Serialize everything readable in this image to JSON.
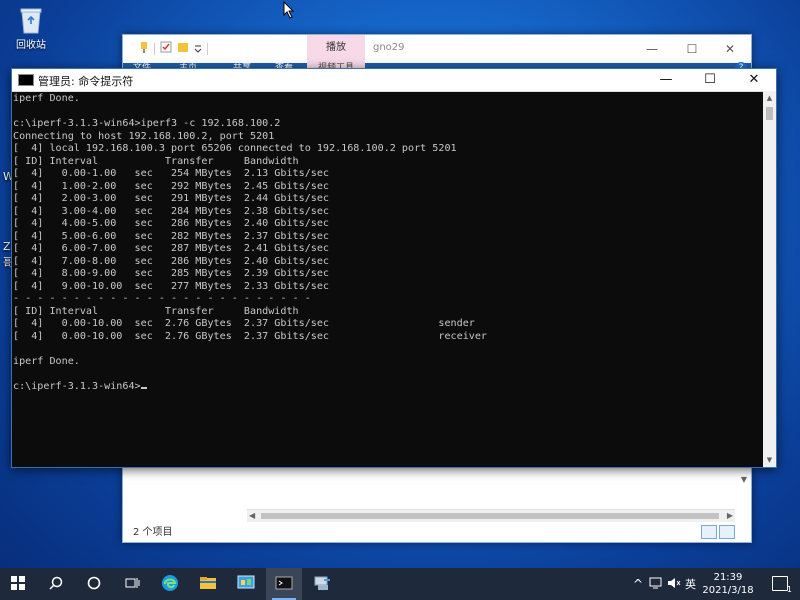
{
  "desktop": {
    "recycle_bin_label": "回收站",
    "left_fragments": [
      "W",
      "Z",
      "哥"
    ]
  },
  "explorer": {
    "context_tab": "播放",
    "title": "gno29",
    "ribbon_tabs": [
      "文件",
      "主页",
      "共享",
      "查看"
    ],
    "ribbon_context_tab": "视频工具",
    "status_text": "2 个项目",
    "controls": {
      "minimize": "—",
      "maximize": "☐",
      "close": "✕"
    },
    "help_icon": "?"
  },
  "cmd": {
    "title": "管理员: 命令提示符",
    "controls": {
      "minimize": "—",
      "maximize": "☐",
      "close": "✕"
    },
    "lines": [
      "iperf Done.",
      "",
      "c:\\iperf-3.1.3-win64>iperf3 -c 192.168.100.2",
      "Connecting to host 192.168.100.2, port 5201",
      "[  4] local 192.168.100.3 port 65206 connected to 192.168.100.2 port 5201",
      "[ ID] Interval           Transfer     Bandwidth",
      "[  4]   0.00-1.00   sec   254 MBytes  2.13 Gbits/sec",
      "[  4]   1.00-2.00   sec   292 MBytes  2.45 Gbits/sec",
      "[  4]   2.00-3.00   sec   291 MBytes  2.44 Gbits/sec",
      "[  4]   3.00-4.00   sec   284 MBytes  2.38 Gbits/sec",
      "[  4]   4.00-5.00   sec   286 MBytes  2.40 Gbits/sec",
      "[  4]   5.00-6.00   sec   282 MBytes  2.37 Gbits/sec",
      "[  4]   6.00-7.00   sec   287 MBytes  2.41 Gbits/sec",
      "[  4]   7.00-8.00   sec   286 MBytes  2.40 Gbits/sec",
      "[  4]   8.00-9.00   sec   285 MBytes  2.39 Gbits/sec",
      "[  4]   9.00-10.00  sec   277 MBytes  2.33 Gbits/sec",
      "- - - - - - - - - - - - - - - - - - - - - - - - -",
      "[ ID] Interval           Transfer     Bandwidth",
      "[  4]   0.00-10.00  sec  2.76 GBytes  2.37 Gbits/sec                  sender",
      "[  4]   0.00-10.00  sec  2.76 GBytes  2.37 Gbits/sec                  receiver",
      "",
      "iperf Done.",
      "",
      "c:\\iperf-3.1.3-win64>"
    ]
  },
  "taskbar": {
    "items": [
      {
        "name": "start-button",
        "icon": "windows-logo-icon"
      },
      {
        "name": "search-button",
        "icon": "search-icon"
      },
      {
        "name": "cortana-button",
        "icon": "circle-icon"
      },
      {
        "name": "task-view-button",
        "icon": "task-view-icon"
      },
      {
        "name": "edge-button",
        "icon": "edge-icon"
      },
      {
        "name": "file-explorer-button",
        "icon": "folder-icon"
      },
      {
        "name": "control-panel-button",
        "icon": "control-panel-icon"
      },
      {
        "name": "cmd-button",
        "icon": "terminal-icon"
      },
      {
        "name": "network-app-button",
        "icon": "network-icon"
      }
    ],
    "tray": {
      "chevron": "^",
      "ime": "英",
      "time": "21:39",
      "date": "2021/3/18",
      "notifications": "1"
    }
  }
}
